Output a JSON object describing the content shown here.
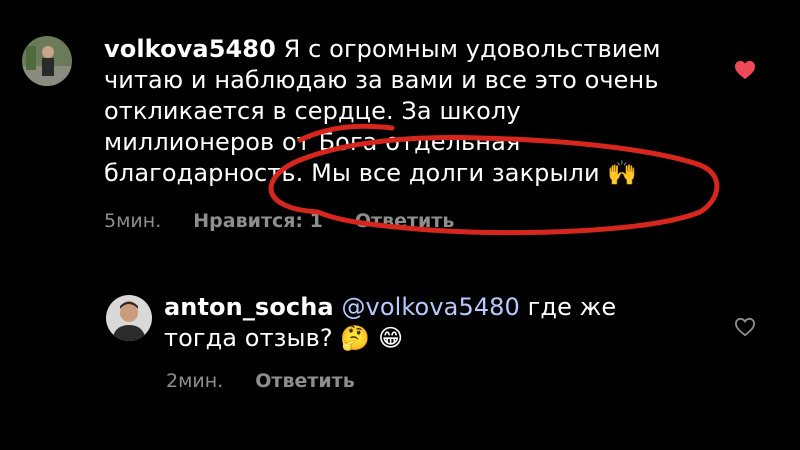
{
  "comments": [
    {
      "username": "volkova5480",
      "text_lines": [
        "Я с огромным удовольствием",
        "читаю и наблюдаю за вами и все это очень",
        "откликается в сердце. За школу",
        "миллионеров от Бога отдельная",
        "благодарность. Мы все долги закрыли"
      ],
      "emoji": "🙌",
      "time": "5мин.",
      "likes_label": "Нравится: 1",
      "reply_label": "Ответить",
      "liked": true
    },
    {
      "username": "anton_socha",
      "mention": "@volkova5480",
      "text_line1_rest": "где же",
      "text_line2": "тогда отзыв?",
      "emojis": "🤔 😁",
      "time": "2мин.",
      "reply_label": "Ответить",
      "liked": false
    }
  ],
  "colors": {
    "background": "#000000",
    "heart_red": "#ed4956",
    "annotation_red": "#d7261e",
    "meta_gray": "#8e8e8e",
    "mention_blue": "#b9c8ff"
  },
  "icons": [
    "heart-filled-icon",
    "heart-outline-icon"
  ]
}
